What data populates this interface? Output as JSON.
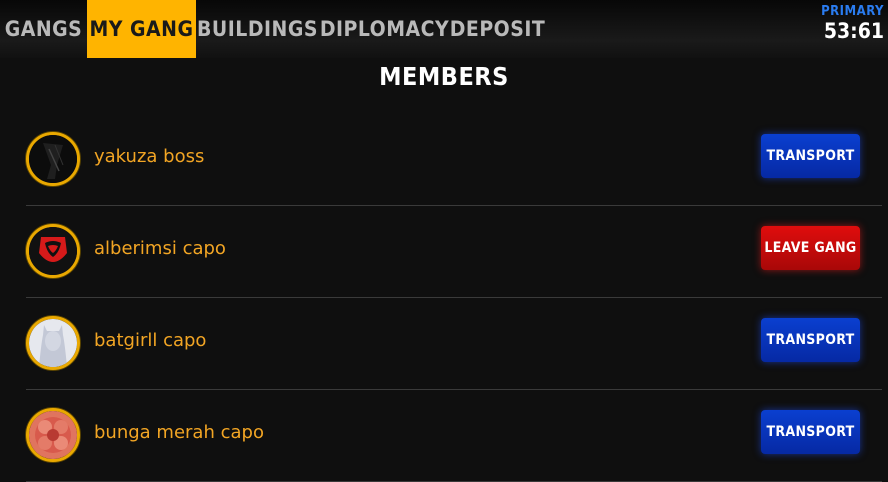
{
  "nav": {
    "tabs": [
      {
        "label": "GANGS",
        "active": false
      },
      {
        "label": "MY GANG",
        "active": true
      },
      {
        "label": "BUILDINGS",
        "active": false
      },
      {
        "label": "DIPLOMACY",
        "active": false
      },
      {
        "label": "DEPOSIT",
        "active": false
      }
    ]
  },
  "timer": {
    "label": "PRIMARY",
    "value": "53:61"
  },
  "section_title": "MEMBERS",
  "members": [
    {
      "name": "yakuza boss",
      "avatar": "yakuza-avatar-icon",
      "action": "TRANSPORT",
      "action_color": "#0a3fd0"
    },
    {
      "name": "alberimsi capo",
      "avatar": "red-emblem-avatar-icon",
      "action": "LEAVE GANG",
      "action_color": "#e00d0d"
    },
    {
      "name": "batgirll capo",
      "avatar": "bat-silhouette-avatar-icon",
      "action": "TRANSPORT",
      "action_color": "#0a3fd0"
    },
    {
      "name": "bunga merah capo",
      "avatar": "red-flower-avatar-icon",
      "action": "TRANSPORT",
      "action_color": "#0a3fd0"
    }
  ],
  "colors": {
    "accent": "#ffb400",
    "name_text": "#f2a524",
    "timer_label": "#2a7cf0"
  }
}
